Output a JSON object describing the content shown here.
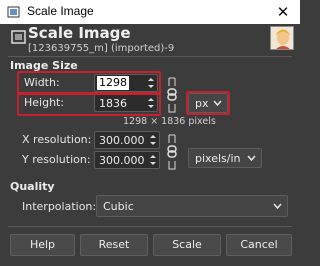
{
  "window": {
    "title": "Scale Image",
    "close_glyph": "✕",
    "app_icon": "gimp-icon"
  },
  "header": {
    "title": "Scale Image",
    "subtitle": "[123639755_m] (imported)-9",
    "icon": "scale-image-icon"
  },
  "image_size": {
    "section_label": "Image Size",
    "width_label": "Width:",
    "width_value": "1298",
    "height_label": "Height:",
    "height_value": "1836",
    "pixel_dimensions": "1298 × 1836 pixels",
    "unit": "px",
    "x_resolution_label": "X resolution:",
    "x_resolution_value": "300.000",
    "y_resolution_label": "Y resolution:",
    "y_resolution_value": "300.000",
    "resolution_unit": "pixels/in"
  },
  "quality": {
    "section_label": "Quality",
    "interpolation_label": "Interpolation:",
    "interpolation_value": "Cubic"
  },
  "buttons": {
    "help": "Help",
    "reset": "Reset",
    "scale": "Scale",
    "cancel": "Cancel"
  },
  "colors": {
    "background": "#3c3c3c",
    "highlight": "#c4202e",
    "field": "#2c2c2c"
  }
}
